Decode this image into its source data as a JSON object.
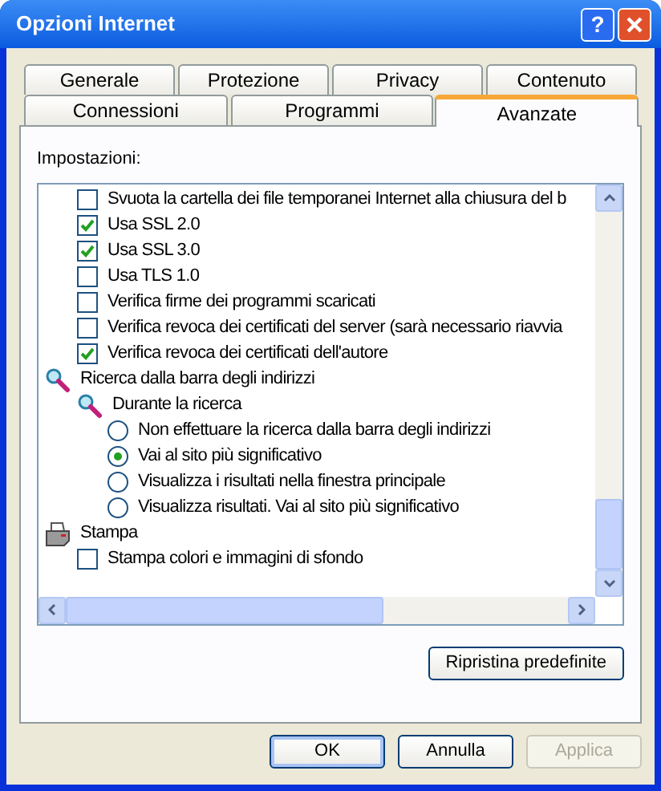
{
  "window": {
    "title": "Opzioni Internet",
    "help_button": "?"
  },
  "tab_rows": [
    [
      {
        "label": "Generale",
        "selected": false
      },
      {
        "label": "Protezione",
        "selected": false
      },
      {
        "label": "Privacy",
        "selected": false
      },
      {
        "label": "Contenuto",
        "selected": false
      }
    ],
    [
      {
        "label": "Connessioni",
        "selected": false
      },
      {
        "label": "Programmi",
        "selected": false
      },
      {
        "label": "Avanzate",
        "selected": true
      }
    ]
  ],
  "settings": {
    "label": "Impostazioni:",
    "items": [
      {
        "kind": "checkbox",
        "label": "Svuota la cartella dei file temporanei Internet alla chiusura del b",
        "checked": false
      },
      {
        "kind": "checkbox",
        "label": "Usa SSL 2.0",
        "checked": true
      },
      {
        "kind": "checkbox",
        "label": "Usa SSL 3.0",
        "checked": true
      },
      {
        "kind": "checkbox",
        "label": "Usa TLS 1.0",
        "checked": false
      },
      {
        "kind": "checkbox",
        "label": "Verifica firme dei programmi scaricati",
        "checked": false
      },
      {
        "kind": "checkbox",
        "label": "Verifica revoca dei certificati del server (sarà necessario riavvia",
        "checked": false
      },
      {
        "kind": "checkbox",
        "label": "Verifica revoca dei certificati dell'autore",
        "checked": true
      },
      {
        "kind": "search",
        "label": "Ricerca dalla barra degli indirizzi",
        "children": [
          {
            "kind": "search",
            "label": "Durante la ricerca",
            "children": [
              {
                "kind": "radio",
                "label": "Non effettuare la ricerca dalla barra degli indirizzi",
                "selected": false
              },
              {
                "kind": "radio",
                "label": "Vai al sito più significativo",
                "selected": true
              },
              {
                "kind": "radio",
                "label": "Visualizza i risultati nella finestra principale",
                "selected": false
              },
              {
                "kind": "radio",
                "label": "Visualizza risultati. Vai al sito più significativo",
                "selected": false
              }
            ]
          }
        ]
      },
      {
        "kind": "printer",
        "label": "Stampa",
        "children": [
          {
            "kind": "checkbox",
            "label": "Stampa colori e immagini di sfondo",
            "checked": false
          }
        ]
      }
    ]
  },
  "restore_button": "Ripristina predefinite",
  "buttons": [
    {
      "label": "OK",
      "disabled": false,
      "default": true
    },
    {
      "label": "Annulla",
      "disabled": false,
      "default": false
    },
    {
      "label": "Applica",
      "disabled": true,
      "default": false
    }
  ]
}
